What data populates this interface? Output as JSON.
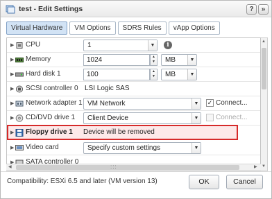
{
  "window": {
    "title": "test - Edit Settings",
    "help_label": "?",
    "expand_label": "»"
  },
  "tabs": [
    {
      "label": "Virtual Hardware",
      "active": true
    },
    {
      "label": "VM Options",
      "active": false
    },
    {
      "label": "SDRS Rules",
      "active": false
    },
    {
      "label": "vApp Options",
      "active": false
    }
  ],
  "devices": {
    "cpu": {
      "label": "CPU",
      "value": "1"
    },
    "memory": {
      "label": "Memory",
      "value": "1024",
      "unit": "MB"
    },
    "hard_disk": {
      "label": "Hard disk 1",
      "value": "100",
      "unit": "MB"
    },
    "scsi": {
      "label": "SCSI controller 0",
      "value": "LSI Logic SAS"
    },
    "network": {
      "label": "Network adapter 1",
      "value": "VM Network",
      "connect_label": "Connect...",
      "connected": true
    },
    "cddvd": {
      "label": "CD/DVD drive 1",
      "value": "Client Device",
      "connect_label": "Connect...",
      "connected": false
    },
    "floppy": {
      "label": "Floppy drive 1",
      "status": "Device will be removed"
    },
    "video": {
      "label": "Video card",
      "value": "Specify custom settings"
    },
    "sata": {
      "label": "SATA controller 0"
    }
  },
  "footer": {
    "compatibility": "Compatibility: ESXi 6.5 and later (VM version 13)",
    "ok_label": "OK",
    "cancel_label": "Cancel"
  },
  "colors": {
    "highlight_border": "#d62a2a",
    "active_tab": "#d2e3f5"
  }
}
